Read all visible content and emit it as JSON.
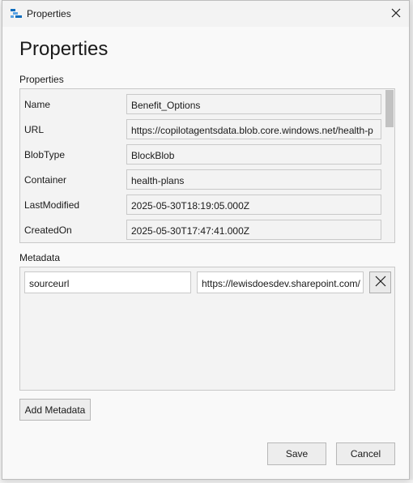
{
  "window": {
    "title": "Properties",
    "app_icon": "storage-explorer-icon",
    "close_icon": "close-icon"
  },
  "heading": "Properties",
  "properties_section": {
    "label": "Properties",
    "rows": [
      {
        "name": "Name",
        "value": "Benefit_Options"
      },
      {
        "name": "URL",
        "value": "https://copilotagentsdata.blob.core.windows.net/health-p"
      },
      {
        "name": "BlobType",
        "value": "BlockBlob"
      },
      {
        "name": "Container",
        "value": "health-plans"
      },
      {
        "name": "LastModified",
        "value": "2025-05-30T18:19:05.000Z"
      },
      {
        "name": "CreatedOn",
        "value": "2025-05-30T17:47:41.000Z"
      }
    ]
  },
  "metadata_section": {
    "label": "Metadata",
    "entries": [
      {
        "key": "sourceurl",
        "value": "https://lewisdoesdev.sharepoint.com/",
        "remove_icon": "close-icon"
      }
    ]
  },
  "buttons": {
    "add_metadata": "Add Metadata",
    "save": "Save",
    "cancel": "Cancel"
  },
  "colors": {
    "dialog_bg": "#f9f9f9",
    "border": "#c9c9c9",
    "button_bg": "#ededed",
    "icon_blue": "#0b6cbd"
  }
}
